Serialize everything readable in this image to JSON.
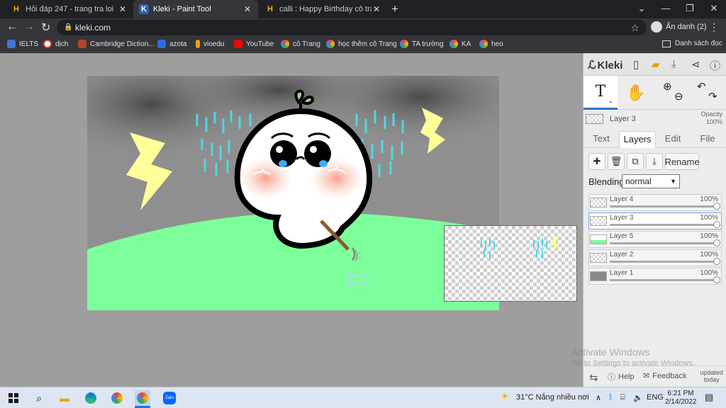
{
  "tabs": [
    {
      "icon": "H",
      "title": "Hỏi đáp 247 - trang tra loi",
      "close": "✕"
    },
    {
      "icon": "K",
      "title": "Kleki - Paint Tool",
      "close": "✕"
    },
    {
      "icon": "H",
      "title": "calli : Happy Birthday cô trang trí",
      "close": "✕"
    }
  ],
  "new_tab": "+",
  "window_controls": {
    "dropdown": "⌄",
    "minimize": "—",
    "restore": "❐",
    "close": "✕"
  },
  "nav": {
    "back": "←",
    "forward": "→",
    "reload": "↻"
  },
  "address": {
    "url": "kleki.com",
    "lock": "🔒",
    "star": "☆"
  },
  "profile": {
    "label": "Ẩn danh (2)"
  },
  "menu": "⋮",
  "bookmarks": [
    {
      "label": "IELTS",
      "color": "#3c78d8"
    },
    {
      "label": "dịch",
      "color": "#ea4335"
    },
    {
      "label": "Cambridge Diction...",
      "color": "#b4462f"
    },
    {
      "label": "azota",
      "color": "#2d6cdf"
    },
    {
      "label": "vioedu",
      "color": "#f4a300"
    },
    {
      "label": "YouTube",
      "color": "#ff0000"
    },
    {
      "label": "cô Trang",
      "color": "#4caf50"
    },
    {
      "label": "học thêm cô Trang",
      "color": "#4caf50"
    },
    {
      "label": "TA trường",
      "color": "#4caf50"
    },
    {
      "label": "KA",
      "color": "#4caf50"
    },
    {
      "label": "heo",
      "color": "#4caf50"
    }
  ],
  "reading_list": "Danh sách đọc",
  "kleki": {
    "logo": "Kleki",
    "current_layer": {
      "name": "Layer 3",
      "opacity_label": "Opacity",
      "opacity_value": "100%"
    },
    "panel_tabs": [
      "Text",
      "Layers",
      "Edit",
      "File"
    ],
    "active_tab": "Layers",
    "rename_label": "Rename",
    "blending_label": "Blending",
    "blending_value": "normal",
    "layers": [
      {
        "name": "Layer 4",
        "opacity": "100%",
        "opacity_frac": 1.0
      },
      {
        "name": "Layer 3",
        "opacity": "100%",
        "opacity_frac": 1.0
      },
      {
        "name": "Layer 5",
        "opacity": "100%",
        "opacity_frac": 1.0
      },
      {
        "name": "Layer 2",
        "opacity": "100%",
        "opacity_frac": 1.0
      },
      {
        "name": "Layer 1",
        "opacity": "100%",
        "opacity_frac": 1.0
      }
    ],
    "footer": {
      "help": "Help",
      "feedback": "Feedback",
      "updated_line1": "updated",
      "updated_line2": "today"
    },
    "canvas_text": {
      "line1": "reinny",
      "line2": "#hd247"
    }
  },
  "activation": {
    "title": "Activate Windows",
    "subtitle": "Go to Settings to activate Windows."
  },
  "taskbar": {
    "weather": "31°C  Nắng nhiều nơi",
    "language": "ENG",
    "time": "6:21 PM",
    "date": "2/14/2022"
  },
  "colors": {
    "grass": "#7cff9a",
    "rain": "#4dd8e6",
    "lightning": "#ffff99",
    "cloud": "#5a5a5a"
  }
}
